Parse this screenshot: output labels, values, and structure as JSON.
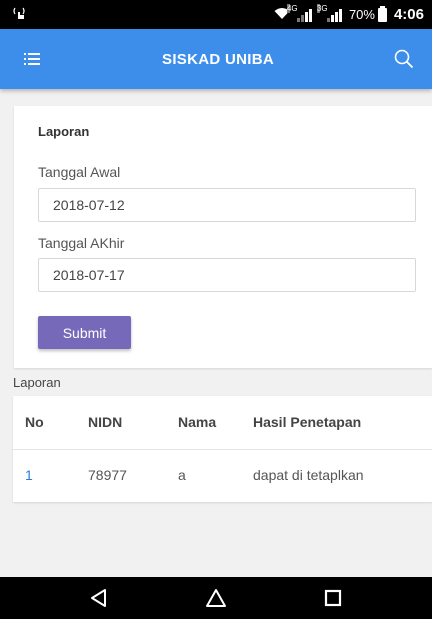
{
  "status_bar": {
    "network_4g": "4G",
    "network_3g": "3G",
    "battery_percent": "70%",
    "time": "4:06"
  },
  "app_bar": {
    "title": "SISKAD UNIBA",
    "background_color": "#3d8eeb"
  },
  "form": {
    "heading": "Laporan",
    "start_label": "Tanggal Awal",
    "start_value": "2018-07-12",
    "end_label": "Tanggal AKhir",
    "end_value": "2018-07-17",
    "submit_label": "Submit",
    "submit_color": "#7769ba"
  },
  "report": {
    "section_label": "Laporan",
    "columns": [
      "No",
      "NIDN",
      "Nama",
      "Hasil Penetapan"
    ],
    "rows": [
      [
        "1",
        "78977",
        "a",
        "dapat di tetaplkan"
      ]
    ]
  },
  "icons": {
    "menu": "menu-list-icon",
    "search": "search-icon",
    "back": "back-triangle-icon",
    "home": "home-icon",
    "recents": "recents-square-icon"
  }
}
